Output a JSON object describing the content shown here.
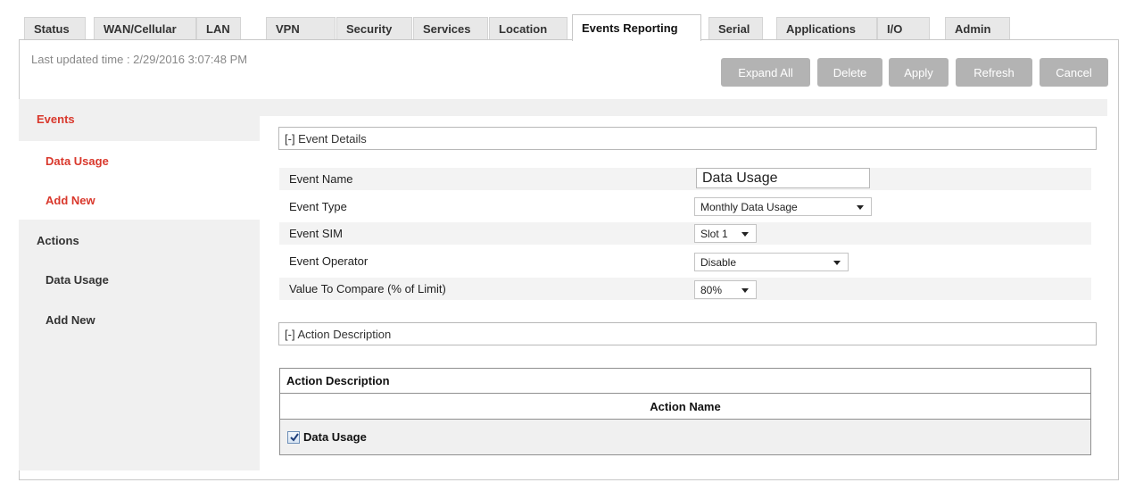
{
  "tabs": [
    {
      "label": "Status",
      "active": false
    },
    {
      "label": "WAN/Cellular",
      "active": false
    },
    {
      "label": "LAN",
      "active": false
    },
    {
      "label": "VPN",
      "active": false
    },
    {
      "label": "Security",
      "active": false
    },
    {
      "label": "Services",
      "active": false
    },
    {
      "label": "Location",
      "active": false
    },
    {
      "label": "Events Reporting",
      "active": true
    },
    {
      "label": "Serial",
      "active": false
    },
    {
      "label": "Applications",
      "active": false
    },
    {
      "label": "I/O",
      "active": false
    },
    {
      "label": "Admin",
      "active": false
    }
  ],
  "last_updated": "Last updated time : 2/29/2016 3:07:48 PM",
  "toolbar": {
    "expand_all": "Expand All",
    "delete": "Delete",
    "apply": "Apply",
    "refresh": "Refresh",
    "cancel": "Cancel"
  },
  "sidebar": {
    "events_heading": "Events",
    "events_items": [
      "Data Usage",
      "Add New"
    ],
    "actions_heading": "Actions",
    "actions_items": [
      "Data Usage",
      "Add New"
    ]
  },
  "event_details": {
    "header": "[-] Event Details",
    "fields": {
      "event_name": {
        "label": "Event Name",
        "value": "Data Usage"
      },
      "event_type": {
        "label": "Event Type",
        "value": "Monthly Data Usage"
      },
      "event_sim": {
        "label": "Event SIM",
        "value": "Slot 1"
      },
      "event_operator": {
        "label": "Event Operator",
        "value": "Disable"
      },
      "value_compare": {
        "label": "Value To Compare (% of Limit)",
        "value": "80%"
      }
    }
  },
  "action_description": {
    "header": "[-] Action Description",
    "table_title": "Action Description",
    "column_header": "Action Name",
    "rows": [
      {
        "label": "Data Usage",
        "checked": true
      }
    ]
  },
  "colors": {
    "accent_red": "#d9382c",
    "button_gray": "#b3b3b3",
    "panel_gray": "#f0f0f0"
  }
}
